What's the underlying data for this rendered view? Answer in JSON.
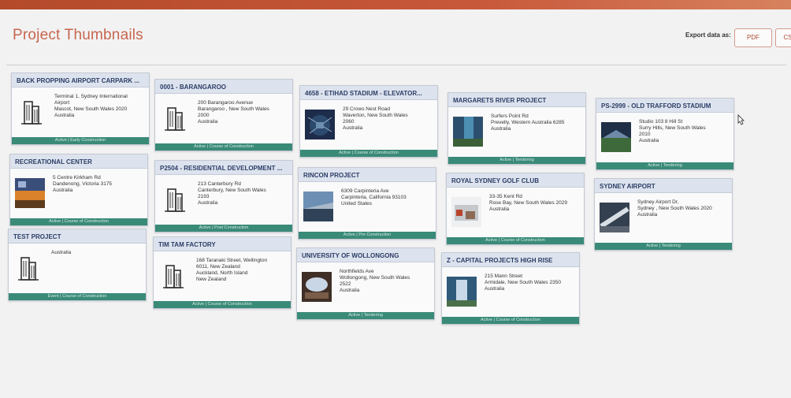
{
  "page": {
    "title": "Project Thumbnails",
    "export_label": "Export data as:",
    "export_buttons": [
      "PDF",
      "CS"
    ]
  },
  "colors": {
    "header_bar": "#c8583a",
    "card_header_bg": "#dde3ee",
    "card_header_text": "#2b3d66",
    "status_bar": "#3a8a78",
    "title": "#c8664e"
  },
  "projects": [
    {
      "name": "BACK PROPPING AIRPORT CARPARK ...",
      "address": [
        "Terminal 1, Sydney International",
        "Airport",
        "Mascot, New South Wales 2020",
        "Australia"
      ],
      "status": "Active | Early Construction",
      "thumb": "building-icon"
    },
    {
      "name": "RECREATIONAL CENTER",
      "address": [
        "5 Centre Kirkham Rd",
        "Dandenong, Victoria 3175",
        "Australia"
      ],
      "status": "Active | Course of Construction",
      "thumb": "photo-recreation"
    },
    {
      "name": "TEST PROJECT",
      "address": [
        "Australia"
      ],
      "status": "Event | Course of Construction",
      "thumb": "building-icon"
    },
    {
      "name": "0001 - BARANGAROO",
      "address": [
        "200 Barangaroo Avenue",
        "Barangaroo , New South Wales",
        "2000",
        "Australia"
      ],
      "status": "Active | Course of Construction",
      "thumb": "building-icon"
    },
    {
      "name": "P2504 - RESIDENTIAL DEVELOPMENT ...",
      "address": [
        "213 Canterbury Rd",
        "Canterbury, New South Wales",
        "2193",
        "Australia"
      ],
      "status": "Active | Post Construction",
      "thumb": "building-icon"
    },
    {
      "name": "TIM TAM FACTORY",
      "address": [
        "168 Taranaki Street, Wellington",
        "6011, New Zealand",
        "Auckland, North Island",
        "New Zealand"
      ],
      "status": "Active | Course of Construction",
      "thumb": "building-icon"
    },
    {
      "name": "4658 - ETIHAD STADIUM - ELEVATOR...",
      "address": [
        "29 Crows Nest Road",
        "Waverton, New South Wales",
        "2060",
        "Australia"
      ],
      "status": "Active | Course of Construction",
      "thumb": "photo-stadium"
    },
    {
      "name": "RINCON PROJECT",
      "address": [
        "6309 Carpinteria Ave",
        "Carpinteria, California 93103",
        "United States"
      ],
      "status": "Active | Pre Construction",
      "thumb": "photo-rincon"
    },
    {
      "name": "UNIVERSITY OF WOLLONGONG",
      "address": [
        "Northfields Ave",
        "Wollongong, New South Wales",
        "2522",
        "Australia"
      ],
      "status": "Active | Tendering",
      "thumb": "photo-university"
    },
    {
      "name": "MARGARETS RIVER PROJECT",
      "address": [
        "Surfers Point Rd",
        "Prevelly, Western Australia 6285",
        "Australia"
      ],
      "status": "Active | Tendering",
      "thumb": "photo-river"
    },
    {
      "name": "ROYAL SYDNEY GOLF CLUB",
      "address": [
        "33-35 Kent Rd",
        "Rose Bay, New South Wales 2029",
        "Australia"
      ],
      "status": "Active | Course of Construction",
      "thumb": "photo-golf"
    },
    {
      "name": "Z - CAPITAL PROJECTS HIGH RISE",
      "address": [
        "215 Mann Street",
        "Armidale, New South Wales 2350",
        "Australia"
      ],
      "status": "Active | Course of Construction",
      "thumb": "photo-highrise"
    },
    {
      "name": "PS-2999 - OLD TRAFFORD STADIUM",
      "address": [
        "Studio 103 8 Hill St",
        "Surry Hills, New South Wales",
        "2010",
        "Australia"
      ],
      "status": "Active | Tendering",
      "thumb": "photo-trafford"
    },
    {
      "name": "SYDNEY AIRPORT",
      "address": [
        "Sydney Airport Dr,",
        "Sydney , New South Wales 2020",
        "Australia"
      ],
      "status": "Active | Tendering",
      "thumb": "photo-airport"
    }
  ]
}
